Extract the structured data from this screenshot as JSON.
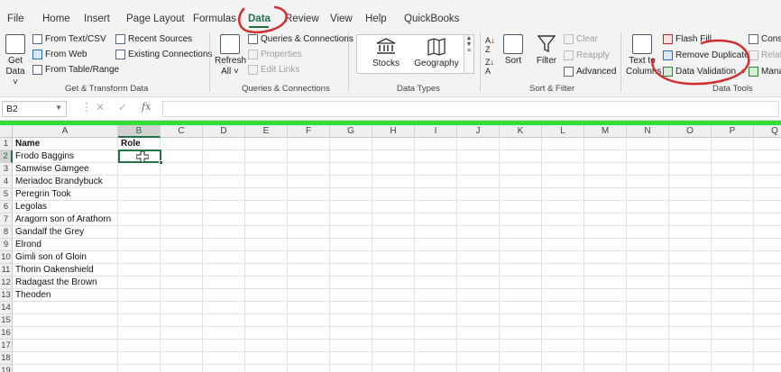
{
  "menu": {
    "tabs": [
      "File",
      "Home",
      "Insert",
      "Page Layout",
      "Formulas",
      "Data",
      "Review",
      "View",
      "Help",
      "QuickBooks"
    ],
    "active_tab": "Data"
  },
  "ribbon": {
    "get_transform": {
      "get_data_line1": "Get",
      "get_data_line2": "Data ˅",
      "from_text_csv": "From Text/CSV",
      "from_web": "From Web",
      "from_table_range": "From Table/Range",
      "recent_sources": "Recent Sources",
      "existing_connections": "Existing Connections",
      "label": "Get & Transform Data"
    },
    "queries": {
      "refresh_line1": "Refresh",
      "refresh_line2": "All ˅",
      "queries_connections": "Queries & Connections",
      "properties": "Properties",
      "edit_links": "Edit Links",
      "label": "Queries & Connections"
    },
    "data_types": {
      "stocks": "Stocks",
      "geography": "Geography",
      "label": "Data Types"
    },
    "sort_filter": {
      "sort": "Sort",
      "filter": "Filter",
      "clear": "Clear",
      "reapply": "Reapply",
      "advanced": "Advanced",
      "label": "Sort & Filter"
    },
    "data_tools": {
      "text_to_line1": "Text to",
      "text_to_line2": "Columns",
      "flash_fill": "Flash Fill",
      "remove_duplicates": "Remove Duplicates",
      "data_validation": "Data Validation",
      "consolidate": "Conso",
      "relationships": "Relati",
      "manage": "Mana",
      "label": "Data Tools"
    }
  },
  "formula_bar": {
    "name_box": "B2",
    "fx": "fx",
    "value": ""
  },
  "sheet": {
    "columns": [
      "A",
      "B",
      "C",
      "D",
      "E",
      "F",
      "G",
      "H",
      "I",
      "J",
      "K",
      "L",
      "M",
      "N",
      "O",
      "P",
      "Q"
    ],
    "selected_column": "B",
    "selected_row": 2,
    "rows": [
      {
        "n": "1",
        "a": "Name",
        "b": "Role"
      },
      {
        "n": "2",
        "a": "Frodo Baggins",
        "b": ""
      },
      {
        "n": "3",
        "a": "Samwise Gamgee",
        "b": ""
      },
      {
        "n": "4",
        "a": "Meriadoc Brandybuck",
        "b": ""
      },
      {
        "n": "5",
        "a": "Peregrin Took",
        "b": ""
      },
      {
        "n": "6",
        "a": "Legolas",
        "b": ""
      },
      {
        "n": "7",
        "a": "Aragorn son of Arathorn",
        "b": ""
      },
      {
        "n": "8",
        "a": "Gandalf the Grey",
        "b": ""
      },
      {
        "n": "9",
        "a": "Elrond",
        "b": ""
      },
      {
        "n": "10",
        "a": "Gimli son of Gloin",
        "b": ""
      },
      {
        "n": "11",
        "a": "Thorin Oakenshield",
        "b": ""
      },
      {
        "n": "12",
        "a": "Radagast the Brown",
        "b": ""
      },
      {
        "n": "13",
        "a": "Theoden",
        "b": ""
      },
      {
        "n": "14",
        "a": "",
        "b": ""
      },
      {
        "n": "15",
        "a": "",
        "b": ""
      },
      {
        "n": "16",
        "a": "",
        "b": ""
      },
      {
        "n": "17",
        "a": "",
        "b": ""
      },
      {
        "n": "18",
        "a": "",
        "b": ""
      },
      {
        "n": "19",
        "a": "",
        "b": ""
      }
    ]
  },
  "colors": {
    "excel_green": "#217346",
    "annotation_red": "#d32f2f",
    "highlight_rule": "#33dd33"
  }
}
